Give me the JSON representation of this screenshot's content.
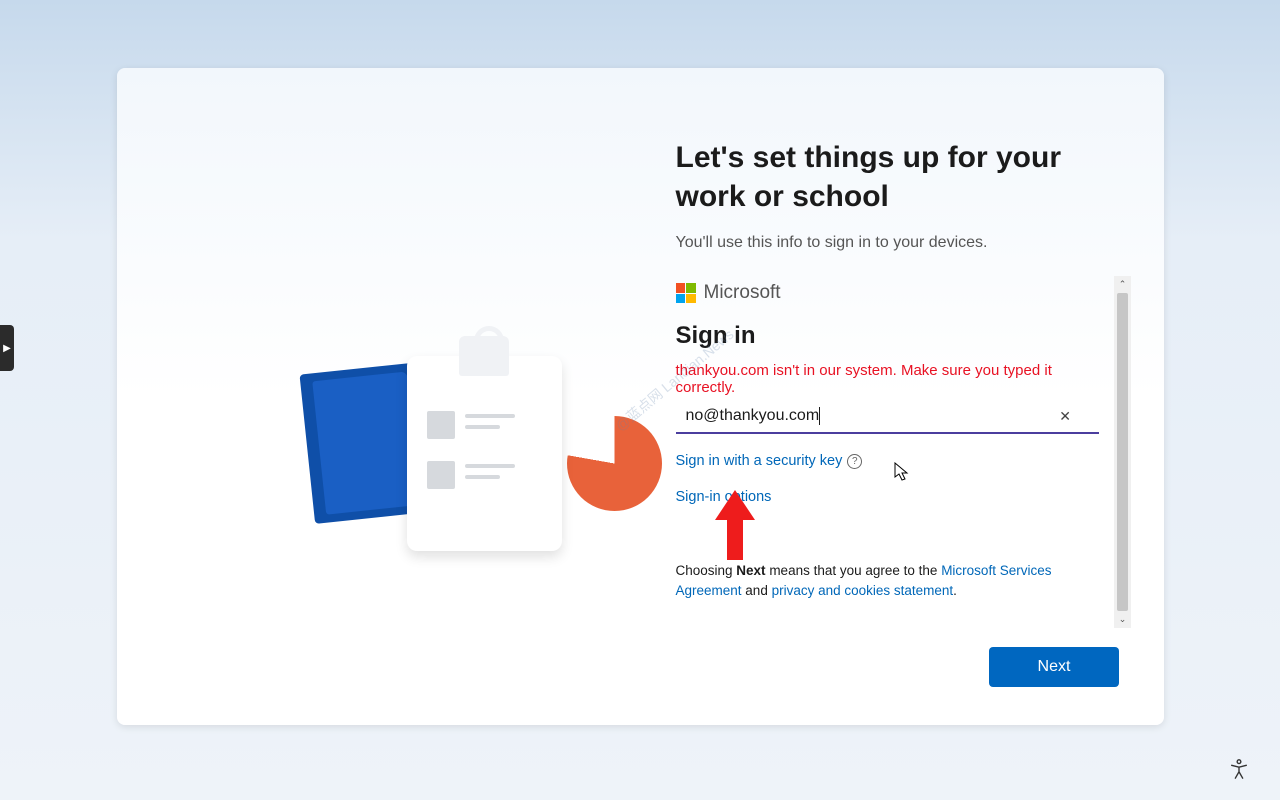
{
  "page": {
    "heading": "Let's set things up for your work or school",
    "subheading": "You'll use this info to sign in to your devices."
  },
  "brand": {
    "name": "Microsoft"
  },
  "signin": {
    "title": "Sign in",
    "error": "thankyou.com isn't in our system. Make sure you typed it correctly.",
    "email_value": "no@thankyou.com",
    "security_key_link": "Sign in with a security key",
    "options_link": "Sign-in options"
  },
  "legal": {
    "prefix": "Choosing ",
    "bold": "Next",
    "mid": " means that you agree to the ",
    "agreement_link": "Microsoft Services Agreement",
    "and": " and ",
    "privacy_link": "privacy and cookies statement",
    "suffix": "."
  },
  "actions": {
    "next": "Next"
  },
  "watermark": "@蓝点网 Landian.News",
  "icons": {
    "help": "?",
    "clear": "✕",
    "side_tab": "▶"
  }
}
